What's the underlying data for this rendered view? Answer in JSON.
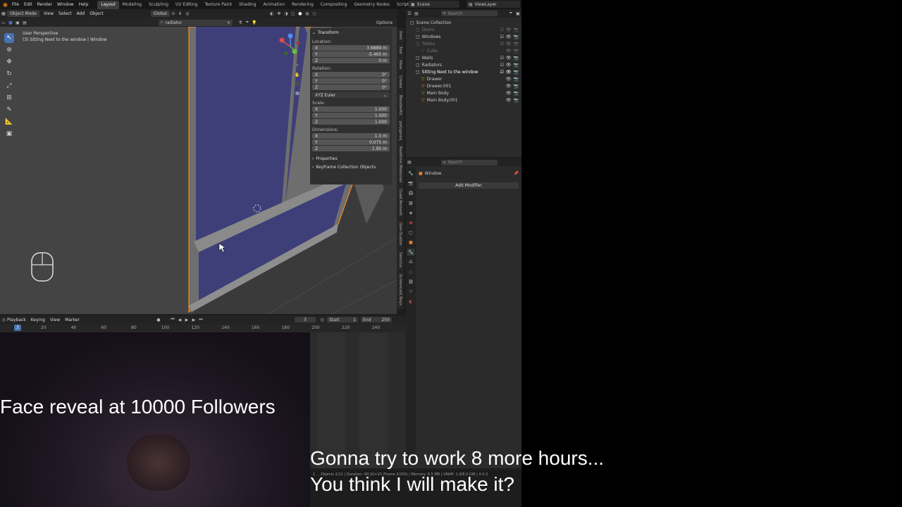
{
  "topbar": {
    "menu": [
      "File",
      "Edit",
      "Render",
      "Window",
      "Help"
    ],
    "workspaces": [
      "Layout",
      "Modeling",
      "Sculpting",
      "UV Editing",
      "Texture Paint",
      "Shading",
      "Animation",
      "Rendering",
      "Compositing",
      "Geometry Nodes",
      "Scripting"
    ],
    "scene": "Scene",
    "view_layer": "ViewLayer"
  },
  "viewport_header": {
    "mode": "Object Mode",
    "menu": [
      "View",
      "Select",
      "Add",
      "Object"
    ],
    "orientation": "Global",
    "search_value": "radiator",
    "options_label": "Options"
  },
  "viewport": {
    "info_line1": "User Perspective",
    "info_line2": "(3) Sitting Next to the window | Window"
  },
  "n_panel": {
    "transform_label": "Transform",
    "location_label": "Location:",
    "location": [
      {
        "axis": "X",
        "value": "3.6889 m"
      },
      {
        "axis": "Y",
        "value": "-5.465 m"
      },
      {
        "axis": "Z",
        "value": "0 m"
      }
    ],
    "rotation_label": "Rotation:",
    "rotation": [
      {
        "axis": "X",
        "value": "0°"
      },
      {
        "axis": "Y",
        "value": "0°"
      },
      {
        "axis": "Z",
        "value": "0°"
      }
    ],
    "rotation_mode": "XYZ Euler",
    "scale_label": "Scale:",
    "scale": [
      {
        "axis": "X",
        "value": "1.000"
      },
      {
        "axis": "Y",
        "value": "1.000"
      },
      {
        "axis": "Z",
        "value": "1.000"
      }
    ],
    "dimensions_label": "Dimensions:",
    "dimensions": [
      {
        "axis": "X",
        "value": "1.5 m"
      },
      {
        "axis": "Y",
        "value": "0.075 m"
      },
      {
        "axis": "Z",
        "value": "1.95 m"
      }
    ],
    "properties_label": "Properties",
    "keyframe_label": "Keyframe Collection Objects",
    "side_tabs": [
      "Item",
      "Tool",
      "View",
      "Create",
      "BlenderKit",
      "polygoniq",
      "Realtime Materials",
      "Quad Remesh",
      "Geo-Scatter",
      "Sanctus",
      "Screencast Keys"
    ]
  },
  "outliner": {
    "search_placeholder": "Search",
    "rows": [
      {
        "label": "Scene Collection",
        "depth": 0,
        "dim": false,
        "checks": false
      },
      {
        "label": "Doors",
        "depth": 1,
        "dim": true,
        "checks": true
      },
      {
        "label": "Windows",
        "depth": 1,
        "dim": false,
        "checks": true
      },
      {
        "label": "Tables",
        "depth": 1,
        "dim": true,
        "checks": true
      },
      {
        "label": "Cube",
        "depth": 2,
        "dim": true,
        "checks": true
      },
      {
        "label": "Walls",
        "depth": 1,
        "dim": false,
        "checks": true
      },
      {
        "label": "Radiators",
        "depth": 1,
        "dim": false,
        "checks": true
      },
      {
        "label": "Sitting Next to the window",
        "depth": 1,
        "dim": false,
        "checks": true
      },
      {
        "label": "Drawer",
        "depth": 2,
        "dim": false,
        "checks": true
      },
      {
        "label": "Drawer.001",
        "depth": 2,
        "dim": false,
        "checks": true
      },
      {
        "label": "Main Body",
        "depth": 2,
        "dim": false,
        "checks": true
      },
      {
        "label": "Main Body.001",
        "depth": 2,
        "dim": false,
        "checks": true
      }
    ]
  },
  "properties": {
    "search_placeholder": "Search",
    "object_name": "Window",
    "add_modifier_label": "Add Modifier"
  },
  "timeline": {
    "menu": [
      "Playback",
      "Keying",
      "View",
      "Marker"
    ],
    "current_frame": "3",
    "start_label": "Start",
    "start_value": "1",
    "end_label": "End",
    "end_value": "250",
    "ruler_ticks": [
      "20",
      "40",
      "60",
      "80",
      "100",
      "120",
      "140",
      "160",
      "180",
      "200",
      "220",
      "240"
    ],
    "playhead_value": "3"
  },
  "statusbar": {
    "text": "1 ... Objects 2/12 | Duration: 00:10+10 (Frame 3/250) | Memory: 6.5 MB | VRAM: 1.9/8.0 GiB | 4.4.3"
  },
  "overlay": {
    "face_reveal": "Face reveal at 10000 Followers",
    "caption_line1": "Gonna try to work 8 more hours...",
    "caption_line2": "You think I will make it?"
  },
  "colors": {
    "accent": "#4772b3",
    "selection_outline": "#f08a24",
    "glass": "#3e3f78",
    "panel_bg": "#303030",
    "header_bg": "#232323"
  }
}
